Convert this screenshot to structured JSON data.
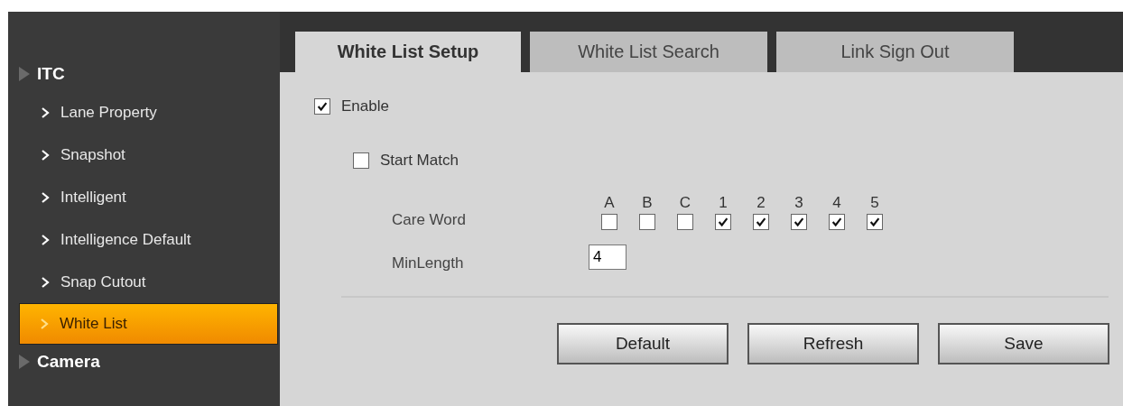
{
  "sidebar": {
    "groups": [
      {
        "label": "ITC",
        "children": [
          {
            "label": "Lane Property",
            "selected": false
          },
          {
            "label": "Snapshot",
            "selected": false
          },
          {
            "label": "Intelligent",
            "selected": false
          },
          {
            "label": "Intelligence Default",
            "selected": false
          },
          {
            "label": "Snap Cutout",
            "selected": false
          },
          {
            "label": "White List",
            "selected": true
          }
        ]
      },
      {
        "label": "Camera"
      }
    ]
  },
  "tabs": [
    {
      "label": "White List Setup",
      "selected": true
    },
    {
      "label": "White List Search",
      "selected": false
    },
    {
      "label": "Link Sign Out",
      "selected": false
    }
  ],
  "enable": {
    "label": "Enable",
    "checked": true
  },
  "start_match": {
    "label": "Start Match",
    "checked": false
  },
  "care_word": {
    "label": "Care Word",
    "options": [
      {
        "label": "A",
        "checked": false
      },
      {
        "label": "B",
        "checked": false
      },
      {
        "label": "C",
        "checked": false
      },
      {
        "label": "1",
        "checked": true
      },
      {
        "label": "2",
        "checked": true
      },
      {
        "label": "3",
        "checked": true
      },
      {
        "label": "4",
        "checked": true
      },
      {
        "label": "5",
        "checked": true
      }
    ]
  },
  "min_length": {
    "label": "MinLength",
    "value": "4"
  },
  "buttons": [
    "Default",
    "Refresh",
    "Save"
  ]
}
